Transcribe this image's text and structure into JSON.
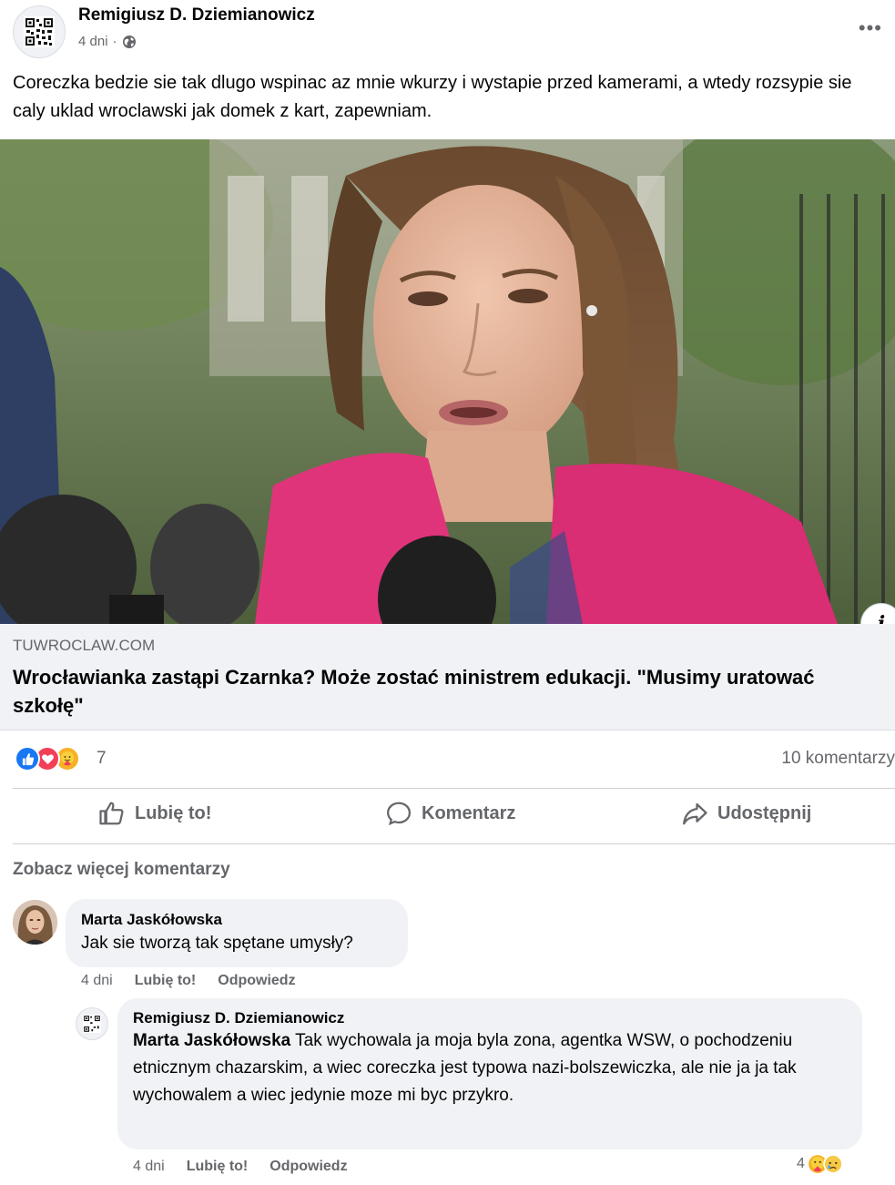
{
  "post": {
    "author": "Remigiusz D. Dziemianowicz",
    "time": "4 dni",
    "separator": "·",
    "text": "Coreczka bedzie sie tak dlugo wspinac az mnie wkurzy i wystapie przed kamerami, a wtedy rozsypie sie caly uklad wroclawski jak domek z kart, zapewniam."
  },
  "link": {
    "domain": "TUWROCLAW.COM",
    "title": "Wrocławianka zastąpi Czarnka? Może zostać ministrem edukacji. \"Musimy uratować szkołę\"",
    "info_label": "i"
  },
  "reactions": {
    "count": "7",
    "comments": "10 komentarzy",
    "icons": [
      "like-icon",
      "love-icon",
      "care-icon"
    ]
  },
  "actions": {
    "like": "Lubię to!",
    "comment": "Komentarz",
    "share": "Udostępnij"
  },
  "see_more": "Zobacz więcej komentarzy",
  "comments": [
    {
      "author": "Marta Jaskółowska",
      "text": "Jak sie tworzą tak spętane umysły?",
      "time": "4 dni",
      "like": "Lubię to!",
      "reply": "Odpowiedz"
    },
    {
      "author": "Remigiusz D. Dziemianowicz",
      "mention": "Marta Jaskółowska",
      "text": " Tak wychowala ja moja byla zona, agentka WSW, o pochodzeniu etnicznym chazarskim, a wiec coreczka jest typowa nazi-bolszewiczka, ale nie ja ja tak wychowalem a wiec jedynie moze mi byc przykro.",
      "time": "4 dni",
      "like": "Lubię to!",
      "reply": "Odpowiedz",
      "reaction_count": "4"
    }
  ],
  "colors": {
    "like_blue": "#1877f2",
    "love_red": "#f33e58",
    "care_yellow": "#f7b125",
    "secondary_text": "#65676b",
    "bubble_bg": "#f0f2f5"
  }
}
